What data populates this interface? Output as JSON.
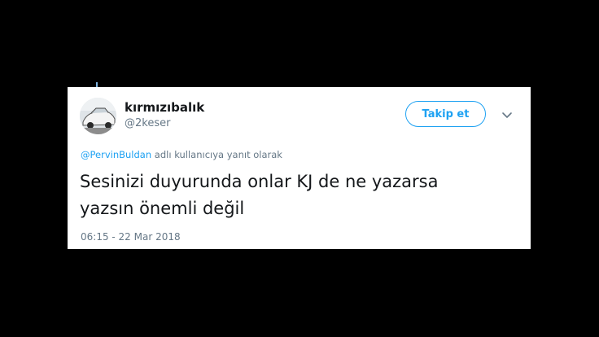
{
  "tweet": {
    "display_name": "kırmızıbalık",
    "handle": "@2keser",
    "follow_label": "Takip et",
    "reply_mention": "@PervinBuldan",
    "reply_suffix": " adlı kullanıcıya yanıt olarak",
    "text_line1": "Sesinizi duyurunda onlar KJ de ne yazarsa",
    "text_line2": "yazsın önemli değil",
    "timestamp": "06:15 - 22 Mar 2018"
  },
  "icons": {
    "avatar": "avatar-car-photo",
    "menu": "chevron-down-icon"
  },
  "colors": {
    "background": "#000000",
    "card": "#ffffff",
    "accent": "#1da1f2",
    "secondary_text": "#657786",
    "primary_text": "#14171a"
  }
}
